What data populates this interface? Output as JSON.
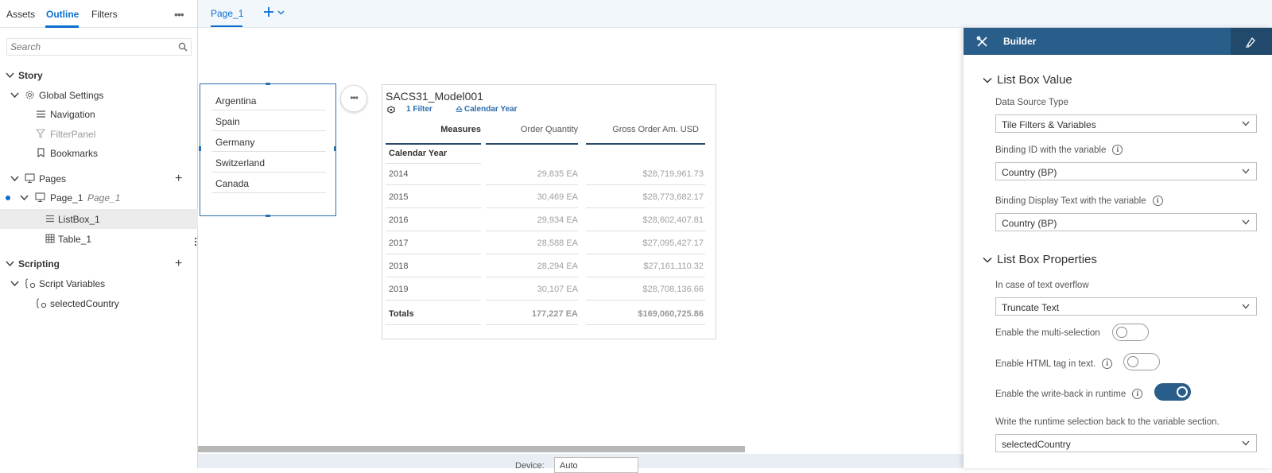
{
  "left_panel": {
    "tabs": [
      "Assets",
      "Outline",
      "Filters"
    ],
    "more_icon": "more-horizontal-icon",
    "search": {
      "placeholder": "Search"
    },
    "tree": {
      "story": "Story",
      "global_settings": "Global Settings",
      "navigation": "Navigation",
      "filter_panel": "FilterPanel",
      "bookmarks": "Bookmarks",
      "pages": "Pages",
      "page_1": "Page_1",
      "page_1_alias": "Page_1",
      "listbox_1": "ListBox_1",
      "table_1": "Table_1",
      "scripting": "Scripting",
      "script_variables": "Script Variables",
      "selected_country": "selectedCountry"
    }
  },
  "canvas": {
    "page_tab": "Page_1",
    "listbox_items": [
      "Argentina",
      "Spain",
      "Germany",
      "Switzerland",
      "Canada"
    ],
    "more_button": "•••",
    "device_label": "Device:",
    "device_value": "Auto"
  },
  "table": {
    "title": "SACS31_Model001",
    "filter_chip": "1 Filter",
    "dimension_chip": "Calendar Year",
    "headers": [
      "Measures",
      "Order Quantity",
      "Gross Order Am. USD"
    ],
    "row_header": "Calendar Year",
    "rows": [
      {
        "label": "2014",
        "qty": "29,835 EA",
        "gross": "$28,719,961.73"
      },
      {
        "label": "2015",
        "qty": "30,469 EA",
        "gross": "$28,773,682.17"
      },
      {
        "label": "2016",
        "qty": "29,934 EA",
        "gross": "$28,602,407.81"
      },
      {
        "label": "2017",
        "qty": "28,588 EA",
        "gross": "$27,095,427.17"
      },
      {
        "label": "2018",
        "qty": "28,294 EA",
        "gross": "$27,161,110.32"
      },
      {
        "label": "2019",
        "qty": "30,107 EA",
        "gross": "$28,708,136.66"
      }
    ],
    "totals": {
      "label": "Totals",
      "qty": "177,227 EA",
      "gross": "$169,060,725.86"
    }
  },
  "builder": {
    "title": "Builder",
    "section1": "List Box Value",
    "data_source_label": "Data Source Type",
    "data_source_value": "Tile Filters & Variables",
    "binding_id_label": "Binding ID with the variable",
    "binding_id_value": "Country (BP)",
    "binding_text_label": "Binding Display Text with the variable",
    "binding_text_value": "Country (BP)",
    "section2": "List Box Properties",
    "overflow_label": "In case of text overflow",
    "overflow_value": "Truncate Text",
    "multi_label": "Enable the multi-selection",
    "multi_on": false,
    "html_label": "Enable HTML tag in text.",
    "html_on": false,
    "writeback_label": "Enable the write-back in runtime",
    "writeback_on": true,
    "runtime_label": "Write the runtime selection back to the variable section.",
    "runtime_value": "selectedCountry"
  },
  "colors": {
    "accent": "#0a6ed1",
    "builder_header": "#2a5e8a"
  }
}
